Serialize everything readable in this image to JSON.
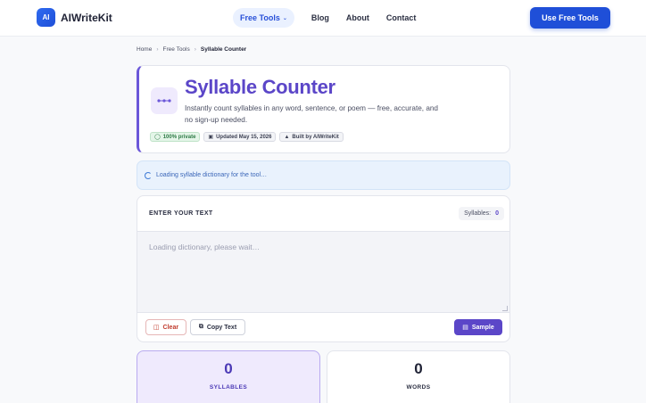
{
  "header": {
    "brand_badge": "AI",
    "brand_name": "AIWriteKit",
    "nav": [
      {
        "label": "Free Tools"
      },
      {
        "label": "Blog"
      },
      {
        "label": "About"
      },
      {
        "label": "Contact"
      }
    ],
    "cta_label": "Use Free Tools"
  },
  "breadcrumb": [
    "Home",
    "Free Tools",
    "Syllable Counter"
  ],
  "hero": {
    "title": "Syllable Counter",
    "description": "Instantly count syllables in any word, sentence, or poem — free, accurate, and no sign-up needed.",
    "badges": [
      "100% private",
      "Updated May 15, 2026",
      "Built by AIWriteKit"
    ]
  },
  "loading_banner": "Loading syllable dictionary for the tool…",
  "editor": {
    "label": "ENTER YOUR TEXT",
    "syllables_label": "Syllables:",
    "syllables_value": "0",
    "placeholder": "Loading dictionary, please wait…",
    "clear_label": "Clear",
    "copy_label": "Copy Text",
    "sample_label": "Sample"
  },
  "stats": [
    {
      "value": "0",
      "label": "SYLLABLES"
    },
    {
      "value": "0",
      "label": "WORDS"
    }
  ],
  "colors": {
    "accent": "#5b46c8",
    "brand_blue": "#1f4fd8",
    "loading_bg": "#e9f2fd",
    "private_badge_green": "#2d7a45"
  }
}
